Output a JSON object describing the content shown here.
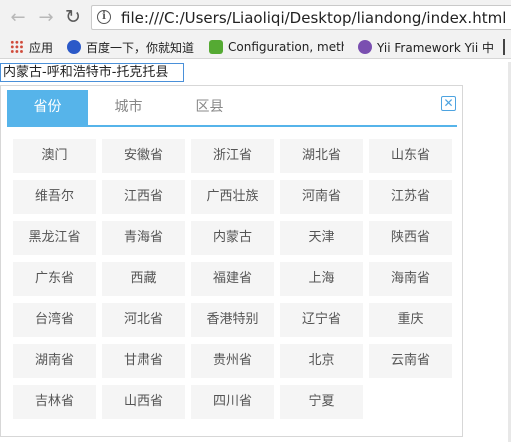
{
  "browser": {
    "url": "file:///C:/Users/Liaoliqi/Desktop/liandong/index.html",
    "bookmarks": [
      {
        "label": "应用",
        "icon": "apps-grid-icon"
      },
      {
        "label": "百度一下，你就知道",
        "icon": "baidu-icon"
      },
      {
        "label": "Configuration, meth",
        "icon": "configuration-icon"
      },
      {
        "label": "Yii Framework Yii 中",
        "icon": "yii-icon"
      }
    ]
  },
  "picker": {
    "input_value": "内蒙古-呼和浩特市-托克托县",
    "tabs": [
      "省份",
      "城市",
      "区县"
    ],
    "active_tab": "省份",
    "close_symbol": "✕",
    "accent_color": "#56b4ea",
    "provinces": [
      "澳门",
      "安徽省",
      "浙江省",
      "湖北省",
      "山东省",
      "维吾尔",
      "江西省",
      "广西壮族",
      "河南省",
      "江苏省",
      "黑龙江省",
      "青海省",
      "内蒙古",
      "天津",
      "陕西省",
      "广东省",
      "西藏",
      "福建省",
      "上海",
      "海南省",
      "台湾省",
      "河北省",
      "香港特别",
      "辽宁省",
      "重庆",
      "湖南省",
      "甘肃省",
      "贵州省",
      "北京",
      "云南省",
      "吉林省",
      "山西省",
      "四川省",
      "宁夏"
    ]
  }
}
